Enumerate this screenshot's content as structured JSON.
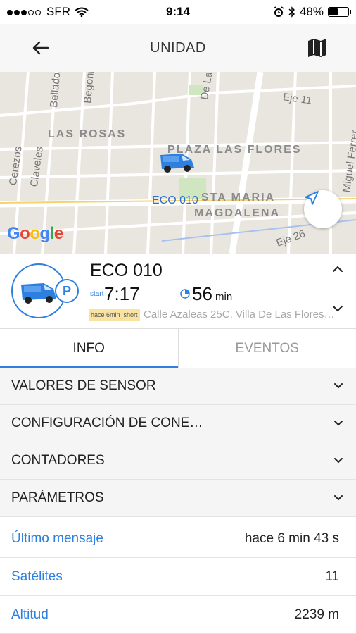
{
  "status_bar": {
    "carrier": "SFR",
    "time": "9:14",
    "battery_percent": "48%",
    "battery_level": 0.48,
    "signal_dots_filled": 3,
    "signal_dots_total": 5
  },
  "nav": {
    "title": "UNIDAD",
    "back_icon": "arrow-left-icon",
    "map_icon": "map-icon"
  },
  "map": {
    "street_labels": [
      "Belladonas",
      "Begonias",
      "Cerezos",
      "Claveles",
      "De La",
      "Eje 11",
      "Miguel Ferrer",
      "Eje 26"
    ],
    "areas": [
      "LAS ROSAS",
      "PLAZA LAS FLORES",
      "STA MARIA",
      "MAGDALENA"
    ],
    "vehicle_label": "ECO 010",
    "provider_logo": "Google",
    "locate_icon": "navigation-arrow-icon"
  },
  "unit": {
    "name": "ECO 010",
    "start_label": "start",
    "start_time": "7:17",
    "duration_value": "56",
    "duration_unit": "min",
    "tag": "hace 6min_short",
    "address": "Calle Azaleas 25C, Villa De Las Flores…",
    "status_badge": "P"
  },
  "tabs": [
    {
      "label": "INFO",
      "active": true
    },
    {
      "label": "EVENTOS",
      "active": false
    }
  ],
  "sections": [
    {
      "label": "VALORES DE SENSOR"
    },
    {
      "label": "CONFIGURACIÓN DE CONE…"
    },
    {
      "label": "CONTADORES"
    },
    {
      "label": "PARÁMETROS"
    }
  ],
  "details": [
    {
      "key": "Último mensaje",
      "value": "hace 6 min 43 s"
    },
    {
      "key": "Satélites",
      "value": "11"
    },
    {
      "key": "Altitud",
      "value": "2239 m"
    }
  ],
  "colors": {
    "accent": "#2d7fe0",
    "tag_bg": "#f8e3a0"
  }
}
